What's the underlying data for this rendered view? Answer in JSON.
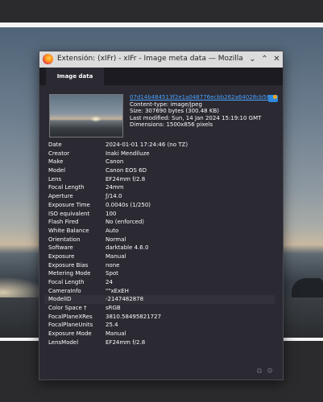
{
  "window": {
    "title": "Extensión: (xIFr) - xIFr - Image meta data — Mozilla Firefox",
    "minimize_icon": "chevron-down-icon",
    "maximize_icon": "chevron-up-icon",
    "close_icon": "close-icon"
  },
  "tabs": [
    {
      "label": "Image data"
    }
  ],
  "image": {
    "filename": "07d14b484513f2e1a048776ecbb262a64028cb56.jpeg",
    "content_type": "Content-type: image/jpeg",
    "size": "Size: 307690 bytes (300.48 KB)",
    "last_modified": "Last modified: Sun, 14 Jan 2024 15:19:10 GMT",
    "dimensions": "Dimensions: 1500x856 pixels"
  },
  "rows": [
    {
      "key": "Date",
      "value": "2024-01-01 17:24:46 (no TZ)"
    },
    {
      "key": "Creator",
      "value": "Inaki Mendiluze"
    },
    {
      "key": "Make",
      "value": "Canon"
    },
    {
      "key": "Model",
      "value": "Canon EOS 6D"
    },
    {
      "key": "Lens",
      "value": "EF24mm f/2.8"
    },
    {
      "key": "Focal Length",
      "value": "24mm"
    },
    {
      "key": "Aperture",
      "value": "ƒ/14.0"
    },
    {
      "key": "Exposure Time",
      "value": "0.0040s (1/250)"
    },
    {
      "key": "ISO equivalent",
      "value": "100"
    },
    {
      "key": "Flash Fired",
      "value": "No (enforced)"
    },
    {
      "key": "White Balance",
      "value": "Auto"
    },
    {
      "key": "Orientation",
      "value": "Normal"
    },
    {
      "key": "Software",
      "value": "darktable 4.6.0"
    },
    {
      "key": "Exposure",
      "value": "Manual"
    },
    {
      "key": "Exposure Bias",
      "value": "none"
    },
    {
      "key": "Metering Mode",
      "value": "Spot"
    },
    {
      "key": "Focal Length",
      "value": "24"
    },
    {
      "key": "CameraInfo",
      "value": "\"\"xExEH"
    },
    {
      "key": "ModelID",
      "value": "-2147482878"
    },
    {
      "key": "Color Space †",
      "value": "sRGB"
    },
    {
      "key": "FocalPlaneXRes",
      "value": "3810.58495821727"
    },
    {
      "key": "FocalPlaneUnits",
      "value": "25.4"
    },
    {
      "key": "Exposure Mode",
      "value": "Manual"
    },
    {
      "key": "LensModel",
      "value": "EF24mm f/2.8"
    }
  ],
  "footer": {
    "copy_icon": "copy-icon",
    "settings_icon": "gear-icon"
  }
}
